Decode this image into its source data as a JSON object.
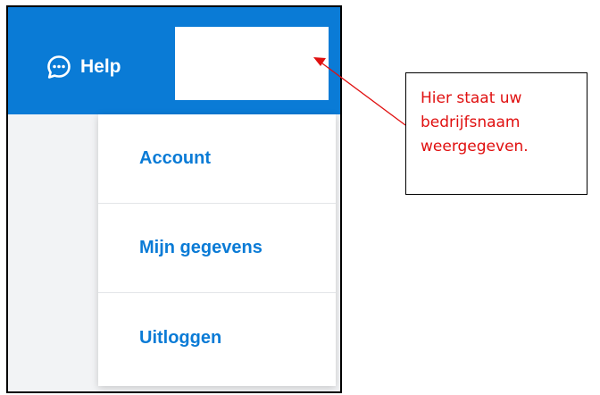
{
  "header": {
    "help_label": "Help",
    "help_icon": "chat-bubble-ellipsis-icon",
    "background_color": "#0a7bd6"
  },
  "company_name_placeholder": "",
  "menu": {
    "items": [
      {
        "label": "Account"
      },
      {
        "label": "Mijn gegevens"
      },
      {
        "label": "Uitloggen"
      }
    ],
    "text_color": "#0a7bd6"
  },
  "annotation": {
    "text": "Hier staat uw\nbedrijfsnaam\nweergegeven.",
    "color": "#e01010"
  }
}
